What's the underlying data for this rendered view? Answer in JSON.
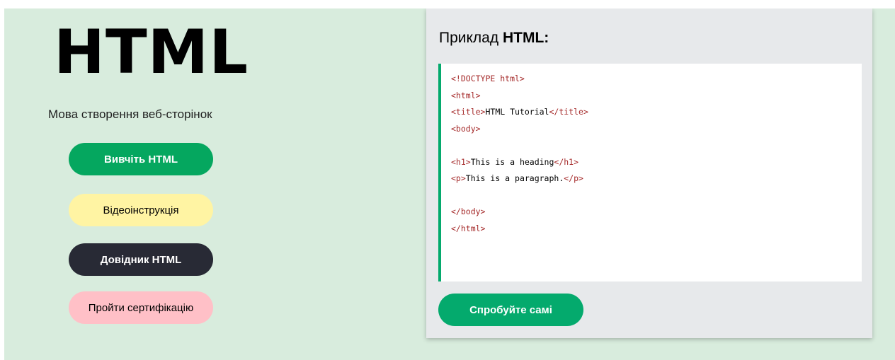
{
  "hero": {
    "title": "HTML",
    "subtitle": "Мова створення веб-сторінок",
    "buttons": {
      "learn": "Вивчіть HTML",
      "video": "Відеоінструкція",
      "reference": "Довідник HTML",
      "certify": "Пройти сертифікацію"
    }
  },
  "example": {
    "title_prefix": "Приклад",
    "title_bold": "HTML:",
    "code": {
      "line1_tag": "<!DOCTYPE html>",
      "line2_tag": "<html>",
      "line3_open": "<title>",
      "line3_text": "HTML Tutorial",
      "line3_close": "</title>",
      "line4_tag": "<body>",
      "line6_open": "<h1>",
      "line6_text": "This is a heading",
      "line6_close": "</h1>",
      "line7_open": "<p>",
      "line7_text": "This is a paragraph.",
      "line7_close": "</p>",
      "line9_tag": "</body>",
      "line10_tag": "</html>"
    },
    "try_button": "Спробуйте самі"
  },
  "colors": {
    "hero_bg": "#d8ecdd",
    "green": "#04aa6d",
    "yellow": "#fff4a3",
    "dark": "#282a35",
    "pink": "#ffc0c7",
    "card_bg": "#e7e9eb",
    "code_tag": "#a52a2a"
  }
}
